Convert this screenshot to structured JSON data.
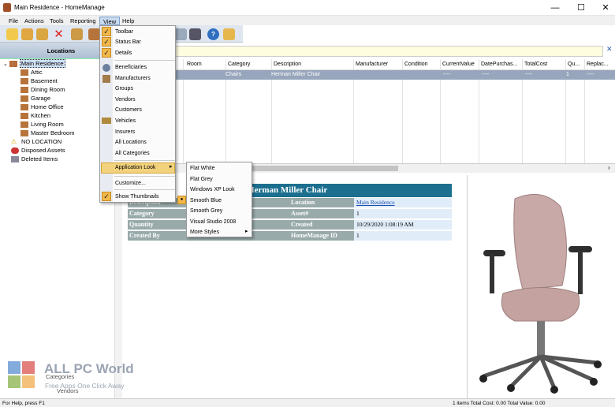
{
  "window": {
    "title": "Main Residence - HomeManage",
    "minimize": "—",
    "maximize": "☐",
    "close": "✕"
  },
  "menubar": {
    "items": [
      "File",
      "Actions",
      "Tools",
      "Reporting",
      "View",
      "Help"
    ]
  },
  "toolbar": {
    "icons": [
      "new-icon",
      "find-icon",
      "search-icon",
      "delete-icon",
      "user-icon",
      "box-icon",
      "table-icon",
      "camera-icon",
      "help-icon",
      "exit-icon"
    ]
  },
  "left_panel": {
    "header": "Locations",
    "tree": [
      {
        "label": "Main Residence",
        "level": 0,
        "icon": "house-icon"
      },
      {
        "label": "Attic",
        "level": 1,
        "icon": "room-icon"
      },
      {
        "label": "Basement",
        "level": 1,
        "icon": "room-icon"
      },
      {
        "label": "Dining Room",
        "level": 1,
        "icon": "room-icon"
      },
      {
        "label": "Garage",
        "level": 1,
        "icon": "room-icon"
      },
      {
        "label": "Home Office",
        "level": 1,
        "icon": "room-icon"
      },
      {
        "label": "Kitchen",
        "level": 1,
        "icon": "room-icon"
      },
      {
        "label": "Living Room",
        "level": 1,
        "icon": "room-icon"
      },
      {
        "label": "Master Bedroom",
        "level": 1,
        "icon": "room-icon"
      },
      {
        "label": "NO LOCATION",
        "level": 0,
        "icon": "warning-icon"
      },
      {
        "label": "Disposed Assets",
        "level": 0,
        "icon": "disposed-icon"
      },
      {
        "label": "Deleted Items",
        "level": 0,
        "icon": "trash-icon"
      }
    ],
    "bottom_items": [
      "Categories",
      "Vendors"
    ]
  },
  "grid": {
    "columns": [
      "Room",
      "Category",
      "Description",
      "Manufacturer",
      "Condition",
      "CurrentValue",
      "DatePurchas...",
      "TotalCost",
      "Qu...",
      "Replac..."
    ],
    "row": [
      "",
      "Chairs",
      "Herman Miller Chair",
      "",
      "",
      "----",
      "----",
      "----",
      "1",
      "----"
    ]
  },
  "detail": {
    "title": "Herman Miller Chair",
    "left_labels": [
      "Description",
      "Category",
      "Quantity",
      "Created By"
    ],
    "right_labels": [
      "Location",
      "Asset#",
      "Created",
      "HomeManage ID"
    ],
    "right_values": [
      "Main Residence",
      "1",
      "10/29/2020 1:08:19 AM",
      "1"
    ]
  },
  "view_menu": {
    "items": [
      {
        "label": "Toolbar",
        "checked": true
      },
      {
        "label": "Status Bar",
        "checked": true
      },
      {
        "label": "Details",
        "checked": true
      },
      {
        "label": "Beneficiaries",
        "icon": "person-icon"
      },
      {
        "label": "Manufacturers",
        "icon": "factory-icon"
      },
      {
        "label": "Groups"
      },
      {
        "label": "Vendors"
      },
      {
        "label": "Customers"
      },
      {
        "label": "Vehicles",
        "icon": "truck-icon"
      },
      {
        "label": "Insurers"
      },
      {
        "label": "All Locations"
      },
      {
        "label": "All Categories"
      },
      {
        "label": "Application Look",
        "submenu": true
      },
      {
        "label": "Customize..."
      },
      {
        "label": "Show Thumbnails",
        "checked": true
      }
    ]
  },
  "look_submenu": {
    "items": [
      "Flat White",
      "Flat Grey",
      "Windows XP Look",
      "Smooth Blue",
      "Smooth Grey",
      "Visual Studio 2008",
      "More Styles"
    ],
    "selected": "Smooth Blue"
  },
  "statusbar": {
    "left": "For Help, press F1",
    "right": "1 items  Total Cost: 0.00  Total Value: 0.00"
  },
  "watermark": {
    "brand": "ALL PC World",
    "tagline": "Free Apps One Click Away"
  },
  "colors": {
    "accent": "#1c6f8e",
    "selection": "#97a6bc",
    "menu_check": "#f2b84a"
  }
}
